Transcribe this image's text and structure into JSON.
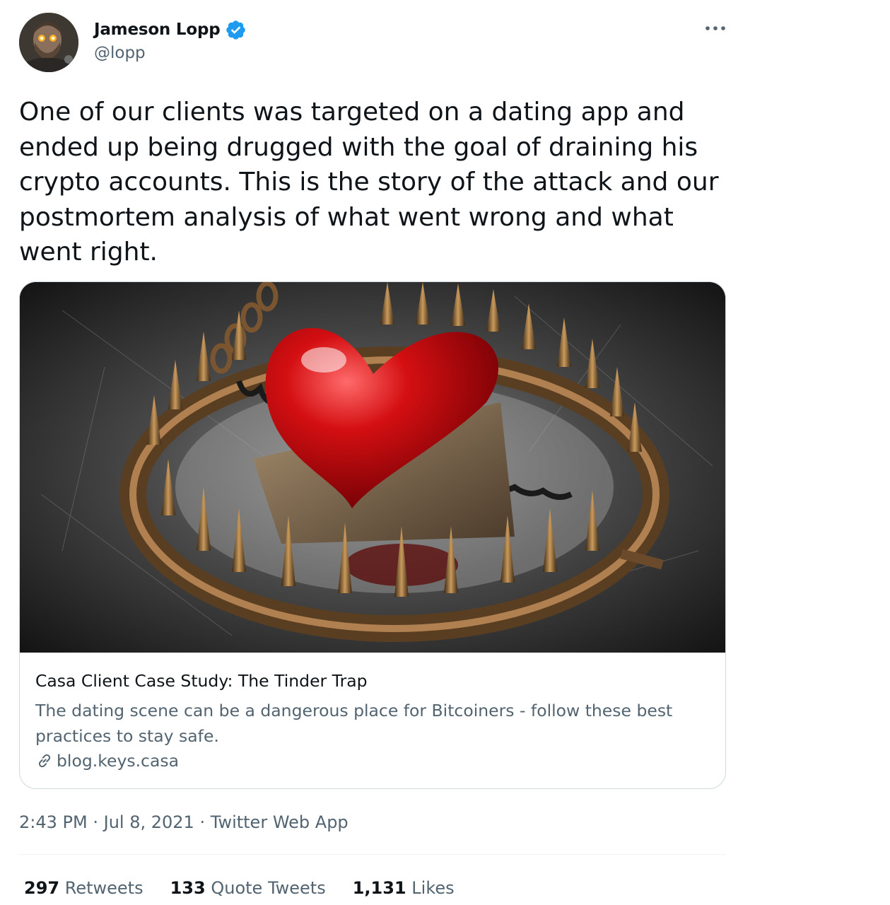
{
  "author": {
    "name": "Jameson Lopp",
    "handle": "@lopp",
    "verified": true
  },
  "tweet": {
    "text": "One of our clients was targeted on a dating app and\nended up being drugged with the goal of draining his\ncrypto accounts. This is the story of the attack and our\npostmortem analysis of what went wrong and what\nwent right."
  },
  "card": {
    "image": "heart-in-bear-trap",
    "title": "Casa Client Case Study: The Tinder Trap",
    "description": "The dating scene can be a dangerous place for Bitcoiners - follow these best practices to stay safe.",
    "domain": "blog.keys.casa"
  },
  "meta": {
    "time": "2:43 PM",
    "separator": "·",
    "date": "Jul 8, 2021",
    "source": "Twitter Web App"
  },
  "stats": {
    "retweets_count": "297",
    "retweets_label": "Retweets",
    "quotes_count": "133",
    "quotes_label": "Quote Tweets",
    "likes_count": "1,131",
    "likes_label": "Likes"
  },
  "colors": {
    "verified": "#1d9bf0",
    "text_primary": "#0f1419",
    "text_secondary": "#536471",
    "border": "#cfd9de"
  },
  "icons": {
    "verified": "verified-badge-icon",
    "more": "more-dots-icon",
    "link": "link-icon"
  }
}
